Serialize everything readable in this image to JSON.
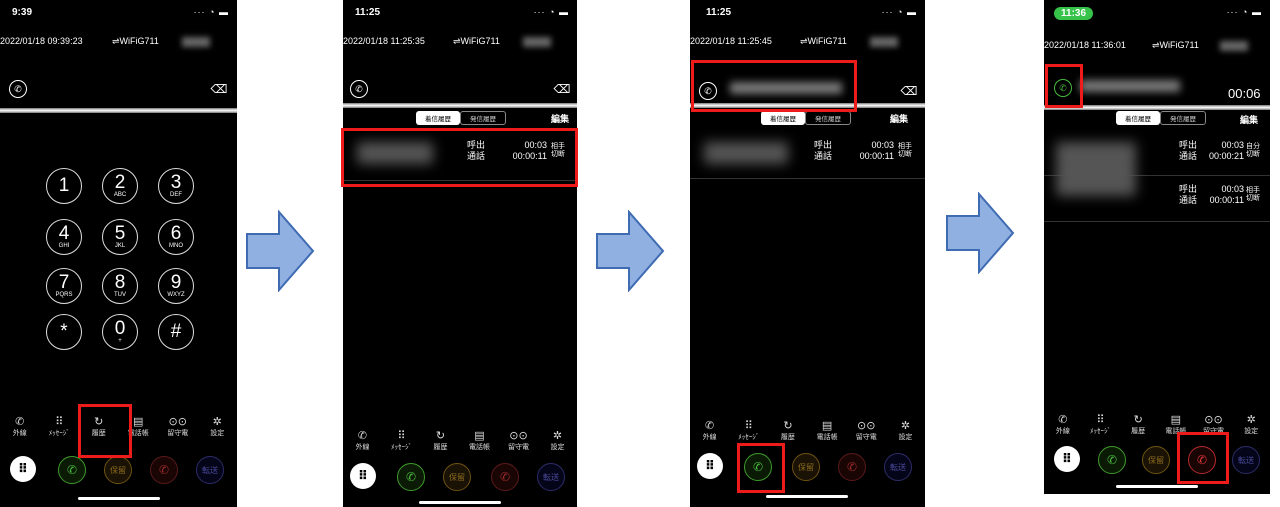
{
  "screens": [
    {
      "clock": "9:39",
      "datetime": "2022/01/18 09:39:23",
      "network": "⇌WiFiG711",
      "keys": [
        {
          "d": "1",
          "l": ""
        },
        {
          "d": "2",
          "l": "ABC"
        },
        {
          "d": "3",
          "l": "DEF"
        },
        {
          "d": "4",
          "l": "GHI"
        },
        {
          "d": "5",
          "l": "JKL"
        },
        {
          "d": "6",
          "l": "MNO"
        },
        {
          "d": "7",
          "l": "PQRS"
        },
        {
          "d": "8",
          "l": "TUV"
        },
        {
          "d": "9",
          "l": "WXYZ"
        },
        {
          "d": "*",
          "l": ""
        },
        {
          "d": "0",
          "l": "+"
        },
        {
          "d": "#",
          "l": ""
        }
      ]
    },
    {
      "clock": "11:25",
      "datetime": "2022/01/18 11:25:35",
      "network": "⇌WiFiG711",
      "record": {
        "ring_label": "呼出",
        "ring_value": "00:03",
        "talk_label": "通話",
        "talk_value": "00:00:11",
        "who": "相手\n切断",
        "who_top": "相手",
        "who_bottom": "切断"
      }
    },
    {
      "clock": "11:25",
      "datetime": "2022/01/18 11:25:45",
      "network": "⇌WiFiG711",
      "record": {
        "ring_label": "呼出",
        "ring_value": "00:03",
        "talk_label": "通話",
        "talk_value": "00:00:11",
        "who_top": "相手",
        "who_bottom": "切断"
      }
    },
    {
      "clock": "11:36",
      "datetime": "2022/01/18 11:36:01",
      "network": "⇌WiFiG711",
      "call_timer": "00:06",
      "records": [
        {
          "ring_label": "呼出",
          "ring_value": "00:03",
          "talk_label": "通話",
          "talk_value": "00:00:21",
          "who_top": "自分",
          "who_bottom": "切断"
        },
        {
          "ring_label": "呼出",
          "ring_value": "00:03",
          "talk_label": "通話",
          "talk_value": "00:00:11",
          "who_top": "相手",
          "who_bottom": "切断"
        }
      ]
    }
  ],
  "history_tabs": {
    "incoming": "着信履歴",
    "outgoing": "発信履歴",
    "edit": "編集"
  },
  "tabbar": [
    {
      "icon": "phone-icon",
      "glyph": "✆",
      "label": "外線"
    },
    {
      "icon": "message-icon",
      "glyph": "⠿",
      "label": "ﾒｯｾｰｼﾞ"
    },
    {
      "icon": "history-icon",
      "glyph": "↻",
      "label": "履歴"
    },
    {
      "icon": "phonebook-icon",
      "glyph": "▤",
      "label": "電話帳"
    },
    {
      "icon": "voicemail-icon",
      "glyph": "⊙⊙",
      "label": "留守電"
    },
    {
      "icon": "settings-icon",
      "glyph": "✲",
      "label": "設定"
    }
  ],
  "actions": {
    "grid": "⠿",
    "call": "✆",
    "hold": "保留",
    "end": "✆",
    "transfer": "転送"
  },
  "colors": {
    "highlight": "#ee1b1b",
    "arrow_fill": "#8fb0e0",
    "arrow_stroke": "#3f6bb3",
    "call_green": "#4ab93e",
    "end_red": "#e03535"
  }
}
